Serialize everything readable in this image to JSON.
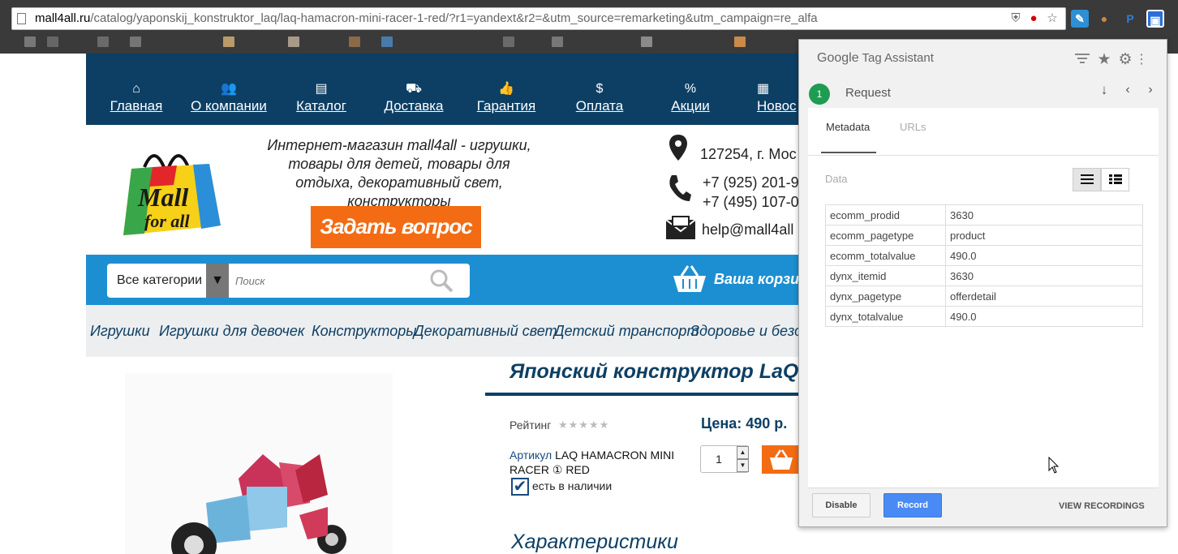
{
  "browser": {
    "url_host": "mall4all.ru",
    "url_rest": "/catalog/yaponskij_konstruktor_laq/laq-hamacron-mini-racer-1-red/?r1=yandext&r2=&utm_source=remarketing&utm_campaign=re_alfa",
    "addr_icons": [
      "shield-icon",
      "opera-icon",
      "star-icon"
    ],
    "extensions": [
      "feather-icon",
      "cookie-icon",
      "p-icon",
      "tag-assistant-icon"
    ]
  },
  "nav": {
    "items": [
      {
        "icon": "home-icon",
        "glyph": "⌂",
        "label": "Главная"
      },
      {
        "icon": "people-icon",
        "glyph": "👥",
        "label": "О компании"
      },
      {
        "icon": "book-icon",
        "glyph": "▤",
        "label": "Каталог"
      },
      {
        "icon": "truck-icon",
        "glyph": "⛟",
        "label": "Доставка"
      },
      {
        "icon": "thumbs-up-icon",
        "glyph": "👍",
        "label": "Гарантия"
      },
      {
        "icon": "money-icon",
        "glyph": "$",
        "label": "Оплата"
      },
      {
        "icon": "percent-icon",
        "glyph": "%",
        "label": "Акции"
      },
      {
        "icon": "calendar-icon",
        "glyph": "▦",
        "label": "Новос"
      }
    ]
  },
  "header": {
    "tagline": "Интернет-магазин mall4all - игрушки, товары для детей, товары для отдыха, декоративный свет, конструкторы",
    "ask_button": "Задать вопрос",
    "address": "127254, г. Мос",
    "phone1": "+7 (925) 201-9",
    "phone2": "+7 (495) 107-0",
    "email": "help@mall4all"
  },
  "search": {
    "category": "Все категории",
    "placeholder": "Поиск"
  },
  "cart": {
    "label": "Ваша корзин"
  },
  "categories": [
    "Игрушки",
    "Игрушки для девочек",
    "Конструкторы",
    "Декоративный свет",
    "Детский транспорт",
    "Здоровье и безо"
  ],
  "product": {
    "title": "Японский конструктор LaQ \"Го",
    "rating_label": "Рейтинг",
    "price": "Цена: 490 р.",
    "sku_label": "Артикул",
    "sku_value_1": "LAQ HAMACRON MINI",
    "sku_value_2": "RACER ① RED",
    "qty": "1",
    "in_stock": "есть в наличии",
    "characteristics": "Характеристики"
  },
  "tag_assistant": {
    "logo_google": "Google",
    "logo_rest": "Tag Assistant",
    "request_number": "1",
    "request_label": "Request",
    "tabs": {
      "metadata": "Metadata",
      "urls": "URLs"
    },
    "data_label": "Data",
    "rows": [
      {
        "key": "ecomm_prodid",
        "value": "3630"
      },
      {
        "key": "ecomm_pagetype",
        "value": "product"
      },
      {
        "key": "ecomm_totalvalue",
        "value": "490.0"
      },
      {
        "key": "dynx_itemid",
        "value": "3630"
      },
      {
        "key": "dynx_pagetype",
        "value": "offerdetail"
      },
      {
        "key": "dynx_totalvalue",
        "value": "490.0"
      }
    ],
    "disable": "Disable",
    "record": "Record",
    "view_recordings": "VIEW RECORDINGS"
  },
  "colors": {
    "nav_bg": "#0d3f64",
    "orange": "#f36b12",
    "blue_bar": "#1c8fd2",
    "record_blue": "#4a8af4",
    "request_green": "#1e9c52"
  }
}
